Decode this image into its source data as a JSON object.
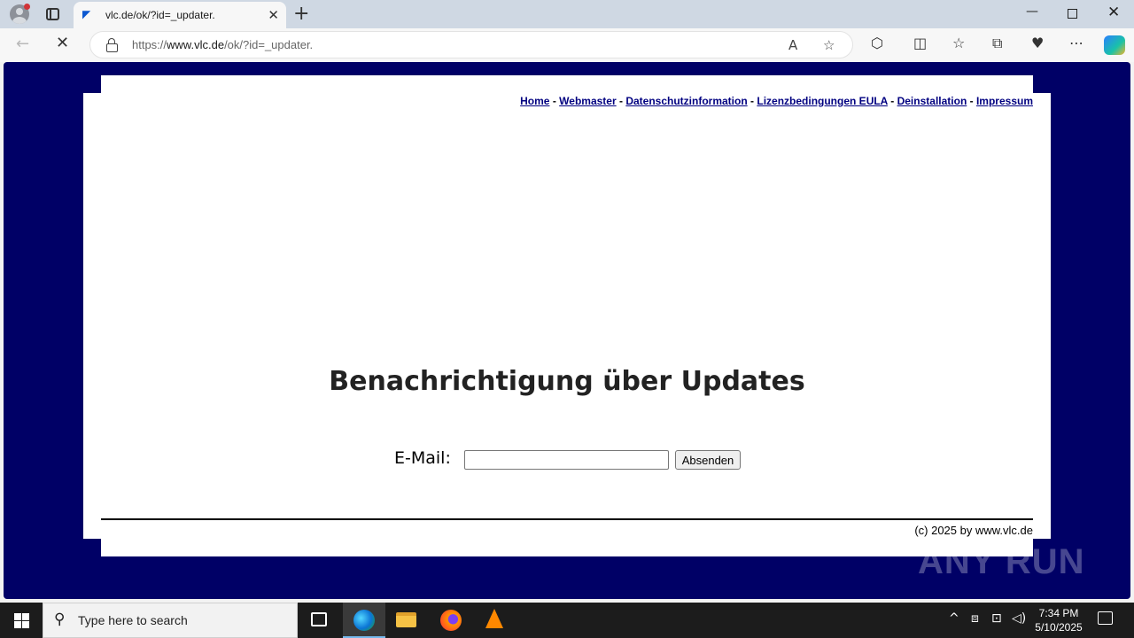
{
  "browser": {
    "tab_title": "vlc.de/ok/?id=_updater.",
    "tab_favicon": "vlc-favicon",
    "url_prefix": "https://",
    "url_host": "www.vlc.de",
    "url_path": "/ok/?id=_updater.",
    "new_tab": "+",
    "close_tab": "✕"
  },
  "page": {
    "nav": [
      "Home",
      "Webmaster",
      "Datenschutzinformation",
      "Lizenzbedingungen EULA",
      "Deinstallation",
      "Impressum"
    ],
    "nav_separator": "-",
    "heading": "Benachrichtigung über Updates",
    "email_label": "E-Mail:",
    "email_value": "",
    "submit_label": "Absenden",
    "copyright": "(c) 2025 by www.vlc.de",
    "background_color": "#000066"
  },
  "watermark": "ANY RUN",
  "taskbar": {
    "search_placeholder": "Type here to search",
    "time": "7:34 PM",
    "date": "5/10/2025"
  }
}
